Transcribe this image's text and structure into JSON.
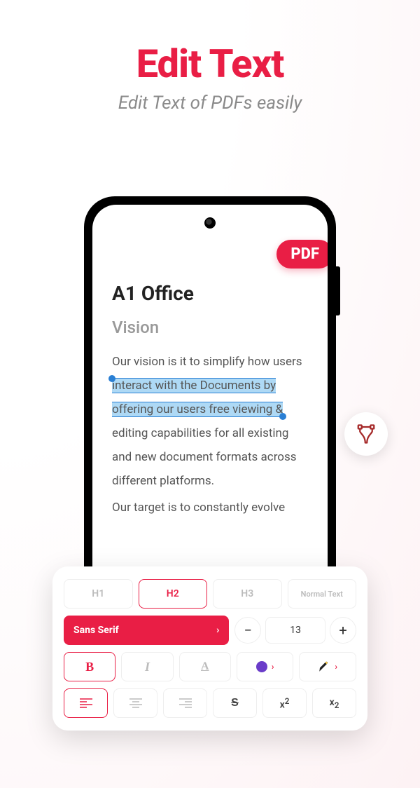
{
  "title": "Edit Text",
  "subtitle": "Edit Text of PDFs easily",
  "badge": "PDF",
  "document": {
    "title": "A1 Office",
    "heading": "Vision",
    "para1_before": "Our vision is it to simplify how users ",
    "para1_highlight": "interact with the Documents by offering our users free viewing & ",
    "para1_after": "editing capabilities for all existing and new document formats across different platforms.",
    "para2": "Our target is to constantly evolve"
  },
  "toolbar": {
    "headings": {
      "h1": "H1",
      "h2": "H2",
      "h3": "H3",
      "normal": "Normal Text"
    },
    "font": "Sans Serif",
    "size": "13",
    "bold": "B",
    "italic": "I",
    "underline": "A",
    "strike": "S",
    "sup_base": "x",
    "sup_exp": "2",
    "sub_base": "x",
    "sub_exp": "2",
    "color": "#6a3cc9"
  }
}
